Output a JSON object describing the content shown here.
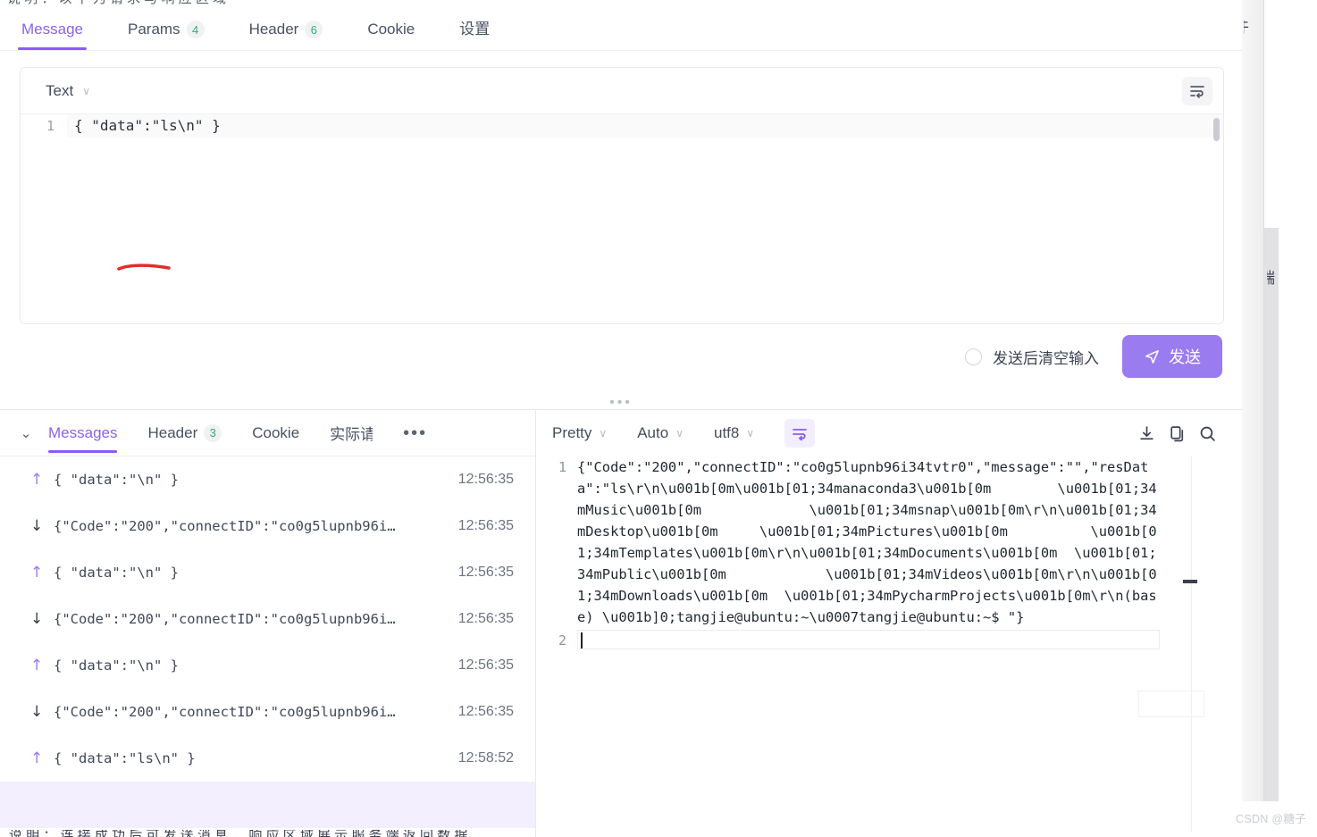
{
  "request_panel": {
    "tabs": [
      {
        "label": "Message",
        "badge": "",
        "active": true
      },
      {
        "label": "Params",
        "badge": "4",
        "active": false
      },
      {
        "label": "Header",
        "badge": "6",
        "active": false
      },
      {
        "label": "Cookie",
        "badge": "",
        "active": false
      },
      {
        "label": "设置",
        "badge": "",
        "active": false
      }
    ],
    "editor": {
      "format_label": "Text",
      "wrap_icon": "word-wrap-icon",
      "line_number": "1",
      "content": "{ \"data\":\"ls\\n\" }"
    },
    "clear_after_send_label": "发送后清空输入",
    "clear_after_send_checked": false,
    "send_button_label": "发送",
    "send_icon": "paper-plane-icon"
  },
  "messages_panel": {
    "collapse_icon": "chevron-down-icon",
    "tabs": [
      {
        "label": "Messages",
        "badge": "",
        "active": true
      },
      {
        "label": "Header",
        "badge": "3",
        "active": false
      },
      {
        "label": "Cookie",
        "badge": "",
        "active": false
      },
      {
        "label": "实际请",
        "badge": "",
        "active": false
      }
    ],
    "overflow_label": "•••",
    "rows": [
      {
        "dir": "up",
        "arrow": "↑",
        "text": "{ \"data\":\"\\n\" }",
        "time": "12:56:35",
        "selected": false
      },
      {
        "dir": "down",
        "arrow": "↓",
        "text": "{\"Code\":\"200\",\"connectID\":\"co0g5lupnb96i…",
        "time": "12:56:35",
        "selected": false
      },
      {
        "dir": "up",
        "arrow": "↑",
        "text": "{ \"data\":\"\\n\" }",
        "time": "12:56:35",
        "selected": false
      },
      {
        "dir": "down",
        "arrow": "↓",
        "text": "{\"Code\":\"200\",\"connectID\":\"co0g5lupnb96i…",
        "time": "12:56:35",
        "selected": false
      },
      {
        "dir": "up",
        "arrow": "↑",
        "text": "{ \"data\":\"\\n\" }",
        "time": "12:56:35",
        "selected": false
      },
      {
        "dir": "down",
        "arrow": "↓",
        "text": "{\"Code\":\"200\",\"connectID\":\"co0g5lupnb96i…",
        "time": "12:56:35",
        "selected": false
      },
      {
        "dir": "up",
        "arrow": "↑",
        "text": "{ \"data\":\"ls\\n\" }",
        "time": "12:58:52",
        "selected": false
      },
      {
        "dir": "up",
        "arrow": "",
        "text": "",
        "time": "",
        "selected": true
      }
    ]
  },
  "response_panel": {
    "toolbar": {
      "pretty_label": "Pretty",
      "auto_label": "Auto",
      "charset_label": "utf8",
      "wrap_icon": "word-wrap-icon",
      "download_icon": "download-icon",
      "copy_icon": "copy-icon",
      "search_icon": "search-icon"
    },
    "line1_number": "1",
    "line2_number": "2",
    "body": "{\"Code\":\"200\",\"connectID\":\"co0g5lupnb96i34tvtr0\",\"message\":\"\",\"resData\":\"ls\\r\\n\\u001b[0m\\u001b[01;34manaconda3\\u001b[0m        \\u001b[01;34mMusic\\u001b[0m             \\u001b[01;34msnap\\u001b[0m\\r\\n\\u001b[01;34mDesktop\\u001b[0m     \\u001b[01;34mPictures\\u001b[0m          \\u001b[01;34mTemplates\\u001b[0m\\r\\n\\u001b[01;34mDocuments\\u001b[0m  \\u001b[01;34mPublic\\u001b[0m            \\u001b[01;34mVideos\\u001b[0m\\r\\n\\u001b[01;34mDownloads\\u001b[0m  \\u001b[01;34mPycharmProjects\\u001b[0m\\r\\n(base) \\u001b]0;tangjie@ubuntu:~\\u0007tangjie@ubuntu:~$ \"}",
    "line2_content": ""
  },
  "right_strip": {
    "top_char": "件",
    "mid_char": "端"
  },
  "top_cut_text": "说 明 ： 以 下 为 请 求 与 响 应 区 域",
  "bottom_cut_text": "说 明 ： 连 接 成 功 后 可 发 送 消 息 ， 响 应 区 域 展 示 服 务 端 返 回 数 据",
  "watermark": "CSDN @糖子",
  "colors": {
    "accent_purple": "#8a5cf5",
    "send_button": "#9b7cf0",
    "badge_green": "#31b06a",
    "selected_row": "#f3effe"
  }
}
